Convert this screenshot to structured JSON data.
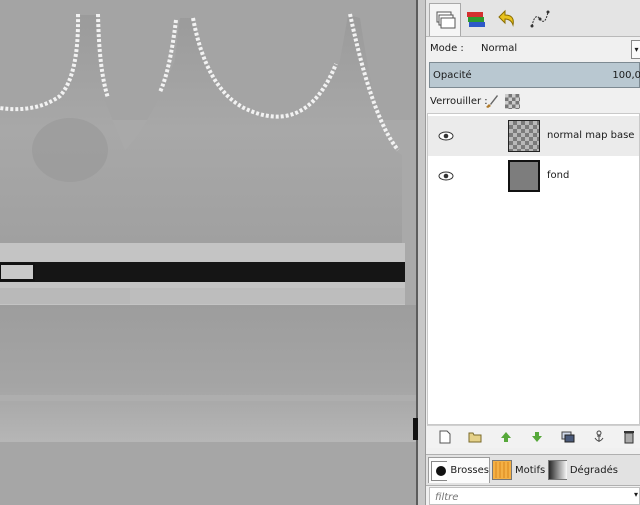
{
  "dock": {
    "tabs": [
      {
        "icon": "layers-icon",
        "active": true
      },
      {
        "icon": "channels-icon",
        "active": false
      },
      {
        "icon": "undo-history-icon",
        "active": false
      },
      {
        "icon": "paths-icon",
        "active": false
      }
    ],
    "mode_label": "Mode :",
    "mode_value": "Normal",
    "opacity_label": "Opacité",
    "opacity_value": "100,0",
    "lock_label": "Verrouiller :",
    "layers": [
      {
        "name": "normal map base",
        "visible": true,
        "selected": true,
        "thumb": "checker"
      },
      {
        "name": "fond",
        "visible": true,
        "selected": false,
        "thumb": "gray"
      }
    ],
    "layer_buttons": [
      "new-layer-icon",
      "layer-group-icon",
      "raise-layer-icon",
      "lower-layer-icon",
      "duplicate-layer-icon",
      "anchor-layer-icon",
      "delete-layer-icon"
    ],
    "bottom_tabs": [
      {
        "label": "Brosses",
        "icon": "brush-icon",
        "active": true
      },
      {
        "label": "Motifs",
        "icon": "pattern-icon",
        "active": false
      },
      {
        "label": "Dégradés",
        "icon": "gradient-icon",
        "active": false
      }
    ],
    "filter_placeholder": "filtre"
  },
  "colors": {
    "accent_opacity": "#b9c8d1",
    "canvas_bg": "#a9a9a9",
    "garment": "#a8a8a8",
    "belt": "#111111"
  }
}
